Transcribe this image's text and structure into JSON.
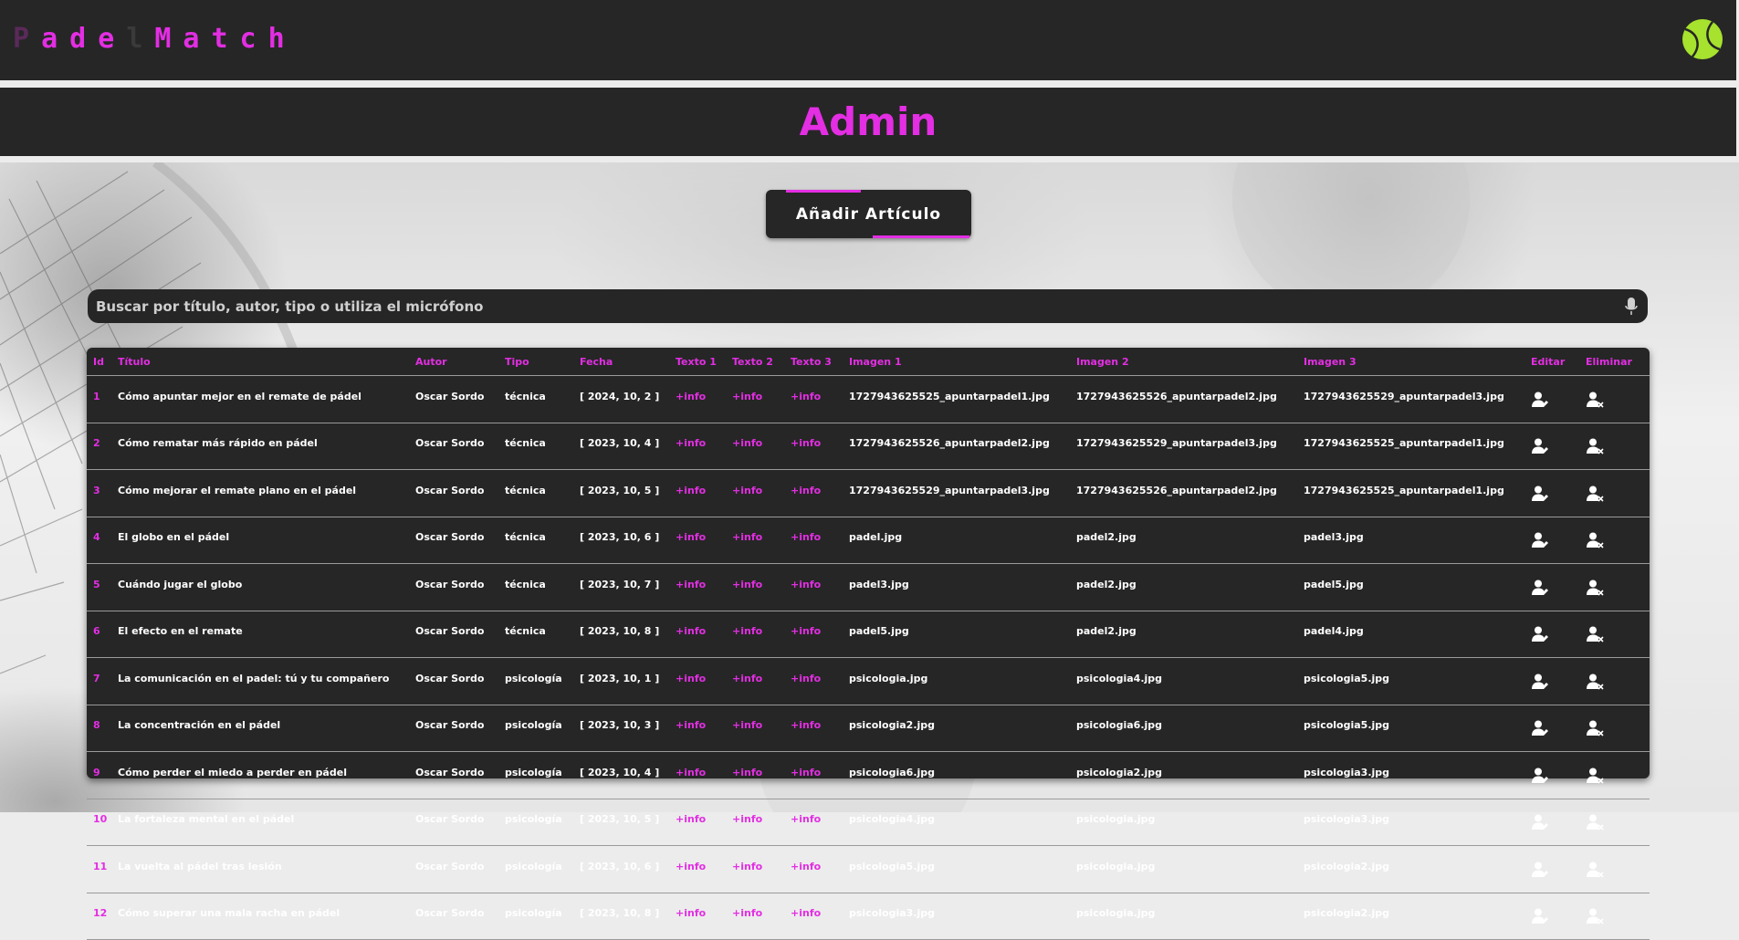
{
  "header": {
    "logo_letters": [
      {
        "ch": "P",
        "color": "#5a2a5a"
      },
      {
        "ch": "a",
        "color": "#e32ee3"
      },
      {
        "ch": "d",
        "color": "#e32ee3"
      },
      {
        "ch": "e",
        "color": "#e32ee3"
      },
      {
        "ch": "l",
        "color": "#3a3a3a"
      },
      {
        "ch": "M",
        "color": "#e32ee3"
      },
      {
        "ch": "a",
        "color": "#e32ee3"
      },
      {
        "ch": "t",
        "color": "#e32ee3"
      },
      {
        "ch": "c",
        "color": "#e32ee3"
      },
      {
        "ch": "h",
        "color": "#e32ee3"
      }
    ],
    "avatar_icon": "tennis-ball-icon"
  },
  "page": {
    "title": "Admin",
    "add_button": "Añadir Artículo"
  },
  "search": {
    "placeholder": "Buscar por título, autor, tipo o utiliza el micrófono",
    "icon": "microphone-icon"
  },
  "table": {
    "headers": [
      "Id",
      "Título",
      "Autor",
      "Tipo",
      "Fecha",
      "Texto 1",
      "Texto 2",
      "Texto 3",
      "Imagen 1",
      "Imagen 2",
      "Imagen 3",
      "Editar",
      "Eliminar"
    ],
    "rows": [
      {
        "id": "1",
        "titulo": "Cómo apuntar mejor en el remate de pádel",
        "autor": "Oscar Sordo",
        "tipo": "técnica",
        "fecha": "[ 2024, 10, 2 ]",
        "t1": "+info",
        "t2": "+info",
        "t3": "+info",
        "img1": "1727943625525_apuntarpadel1.jpg",
        "img2": "1727943625526_apuntarpadel2.jpg",
        "img3": "1727943625529_apuntarpadel3.jpg"
      },
      {
        "id": "2",
        "titulo": "Cómo rematar más rápido en pádel",
        "autor": "Oscar Sordo",
        "tipo": "técnica",
        "fecha": "[ 2023, 10, 4 ]",
        "t1": "+info",
        "t2": "+info",
        "t3": "+info",
        "img1": "1727943625526_apuntarpadel2.jpg",
        "img2": "1727943625529_apuntarpadel3.jpg",
        "img3": "1727943625525_apuntarpadel1.jpg"
      },
      {
        "id": "3",
        "titulo": "Cómo mejorar el remate plano en el pádel",
        "autor": "Oscar Sordo",
        "tipo": "técnica",
        "fecha": "[ 2023, 10, 5 ]",
        "t1": "+info",
        "t2": "+info",
        "t3": "+info",
        "img1": "1727943625529_apuntarpadel3.jpg",
        "img2": "1727943625526_apuntarpadel2.jpg",
        "img3": "1727943625525_apuntarpadel1.jpg"
      },
      {
        "id": "4",
        "titulo": "El globo en el pádel",
        "autor": "Oscar Sordo",
        "tipo": "técnica",
        "fecha": "[ 2023, 10, 6 ]",
        "t1": "+info",
        "t2": "+info",
        "t3": "+info",
        "img1": "padel.jpg",
        "img2": "padel2.jpg",
        "img3": "padel3.jpg"
      },
      {
        "id": "5",
        "titulo": "Cuándo jugar el globo",
        "autor": "Oscar Sordo",
        "tipo": "técnica",
        "fecha": "[ 2023, 10, 7 ]",
        "t1": "+info",
        "t2": "+info",
        "t3": "+info",
        "img1": "padel3.jpg",
        "img2": "padel2.jpg",
        "img3": "padel5.jpg"
      },
      {
        "id": "6",
        "titulo": "El efecto en el remate",
        "autor": "Oscar Sordo",
        "tipo": "técnica",
        "fecha": "[ 2023, 10, 8 ]",
        "t1": "+info",
        "t2": "+info",
        "t3": "+info",
        "img1": "padel5.jpg",
        "img2": "padel2.jpg",
        "img3": "padel4.jpg"
      },
      {
        "id": "7",
        "titulo": "La comunicación en el padel: tú y tu compañero",
        "autor": "Oscar Sordo",
        "tipo": "psicología",
        "fecha": "[ 2023, 10, 1 ]",
        "t1": "+info",
        "t2": "+info",
        "t3": "+info",
        "img1": "psicologia.jpg",
        "img2": "psicologia4.jpg",
        "img3": "psicologia5.jpg"
      },
      {
        "id": "8",
        "titulo": "La concentración en el pádel",
        "autor": "Oscar Sordo",
        "tipo": "psicología",
        "fecha": "[ 2023, 10, 3 ]",
        "t1": "+info",
        "t2": "+info",
        "t3": "+info",
        "img1": "psicologia2.jpg",
        "img2": "psicologia6.jpg",
        "img3": "psicologia5.jpg"
      },
      {
        "id": "9",
        "titulo": "Cómo perder el miedo a perder en pádel",
        "autor": "Oscar Sordo",
        "tipo": "psicología",
        "fecha": "[ 2023, 10, 4 ]",
        "t1": "+info",
        "t2": "+info",
        "t3": "+info",
        "img1": "psicologia6.jpg",
        "img2": "psicologia2.jpg",
        "img3": "psicologia3.jpg"
      },
      {
        "id": "10",
        "titulo": "La fortaleza mental en el pádel",
        "autor": "Oscar Sordo",
        "tipo": "psicología",
        "fecha": "[ 2023, 10, 5 ]",
        "t1": "+info",
        "t2": "+info",
        "t3": "+info",
        "img1": "psicologia4.jpg",
        "img2": "psicologia.jpg",
        "img3": "psicologia3.jpg"
      },
      {
        "id": "11",
        "titulo": "La vuelta al pádel tras lesión",
        "autor": "Oscar Sordo",
        "tipo": "psicología",
        "fecha": "[ 2023, 10, 6 ]",
        "t1": "+info",
        "t2": "+info",
        "t3": "+info",
        "img1": "psicologia5.jpg",
        "img2": "psicologia.jpg",
        "img3": "psicologia2.jpg"
      },
      {
        "id": "12",
        "titulo": "Cómo superar una mala racha en pádel",
        "autor": "Oscar Sordo",
        "tipo": "psicología",
        "fecha": "[ 2023, 10, 8 ]",
        "t1": "+info",
        "t2": "+info",
        "t3": "+info",
        "img1": "psicologia3.jpg",
        "img2": "psicologia.jpg",
        "img3": "psicologia2.jpg"
      }
    ],
    "edit_icon": "user-edit-icon",
    "delete_icon": "user-delete-icon"
  },
  "colors": {
    "accent": "#e32ee3",
    "panel": "#262626",
    "ball": "#a6e22e"
  }
}
